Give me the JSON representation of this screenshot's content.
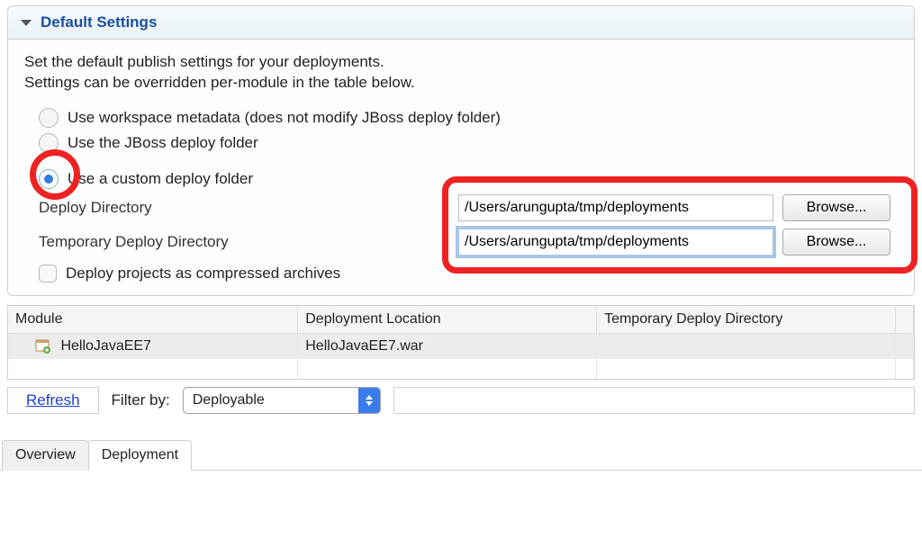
{
  "panel": {
    "title": "Default Settings",
    "intro_line1": "Set the default publish settings for your deployments.",
    "intro_line2": "Settings can be overridden per-module in the table below.",
    "radios": {
      "workspace": "Use workspace metadata (does not modify JBoss deploy folder)",
      "jboss": "Use the JBoss deploy folder",
      "custom": "Use a custom deploy folder"
    },
    "labels": {
      "deploy_dir": "Deploy Directory",
      "temp_dir": "Temporary Deploy Directory"
    },
    "inputs": {
      "deploy_dir": "/Users/arungupta/tmp/deployments",
      "temp_dir": "/Users/arungupta/tmp/deployments"
    },
    "browse": "Browse...",
    "compressed_checkbox": "Deploy projects as compressed archives"
  },
  "table": {
    "headers": {
      "module": "Module",
      "location": "Deployment Location",
      "temp": "Temporary Deploy Directory"
    },
    "rows": [
      {
        "module": "HelloJavaEE7",
        "location": "HelloJavaEE7.war",
        "temp": ""
      }
    ]
  },
  "filter": {
    "refresh": "Refresh",
    "label": "Filter by:",
    "select_value": "Deployable",
    "input_value": ""
  },
  "tabs": {
    "overview": "Overview",
    "deployment": "Deployment"
  }
}
